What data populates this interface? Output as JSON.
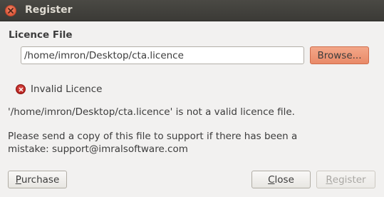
{
  "window": {
    "title": "Register"
  },
  "licence": {
    "section_label": "Licence File",
    "path_value": "/home/imron/Desktop/cta.licence",
    "browse_label": "Browse..."
  },
  "status": {
    "icon": "error-icon",
    "text": "Invalid Licence"
  },
  "messages": {
    "line1": "'/home/imron/Desktop/cta.licence' is not a valid licence file.",
    "line2a": "Please send a copy of this file to support if there has been a",
    "line2b": "mistake: support@imralsoftware.com"
  },
  "buttons": {
    "purchase_first": "P",
    "purchase_rest": "urchase",
    "close_first": "C",
    "close_rest": "lose",
    "register_first": "R",
    "register_rest": "egister"
  },
  "colors": {
    "accent": "#e98a68",
    "error": "#c62520",
    "titlebar": "#3e3d39"
  }
}
